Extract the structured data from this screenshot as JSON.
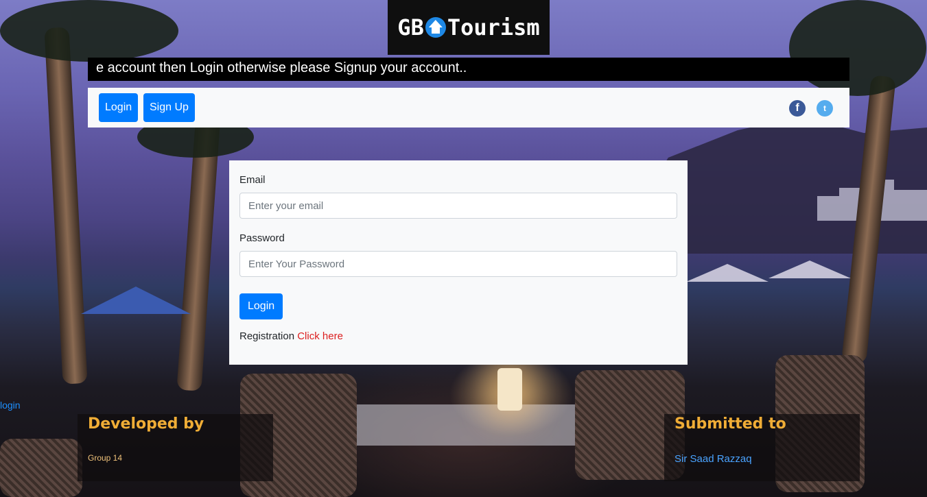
{
  "logo": {
    "prefix": "GB",
    "suffix": "Tourism",
    "icon": "home-icon"
  },
  "marquee": {
    "text": "e account then Login otherwise please Signup your account.."
  },
  "navbar": {
    "login_label": "Login",
    "signup_label": "Sign Up",
    "social": [
      {
        "name": "facebook-icon",
        "glyph": "f",
        "color": "#3b5998"
      },
      {
        "name": "twitter-icon",
        "glyph": "t",
        "color": "#55acee"
      }
    ]
  },
  "login_form": {
    "email_label": "Email",
    "email_placeholder": "Enter your email",
    "password_label": "Password",
    "password_placeholder": "Enter Your Password",
    "submit_label": "Login",
    "registration_text": "Registration",
    "registration_link": "Click here"
  },
  "side_link": "login",
  "footer": {
    "left": {
      "heading": "Developed by",
      "text": "Group 14"
    },
    "right": {
      "heading": "Submitted to",
      "link": "Sir Saad Razzaq"
    }
  },
  "colors": {
    "primary": "#007bff",
    "accent_heading": "#f0ad36",
    "link_red": "#dc1f1f",
    "link_blue": "#4aa3ff"
  }
}
